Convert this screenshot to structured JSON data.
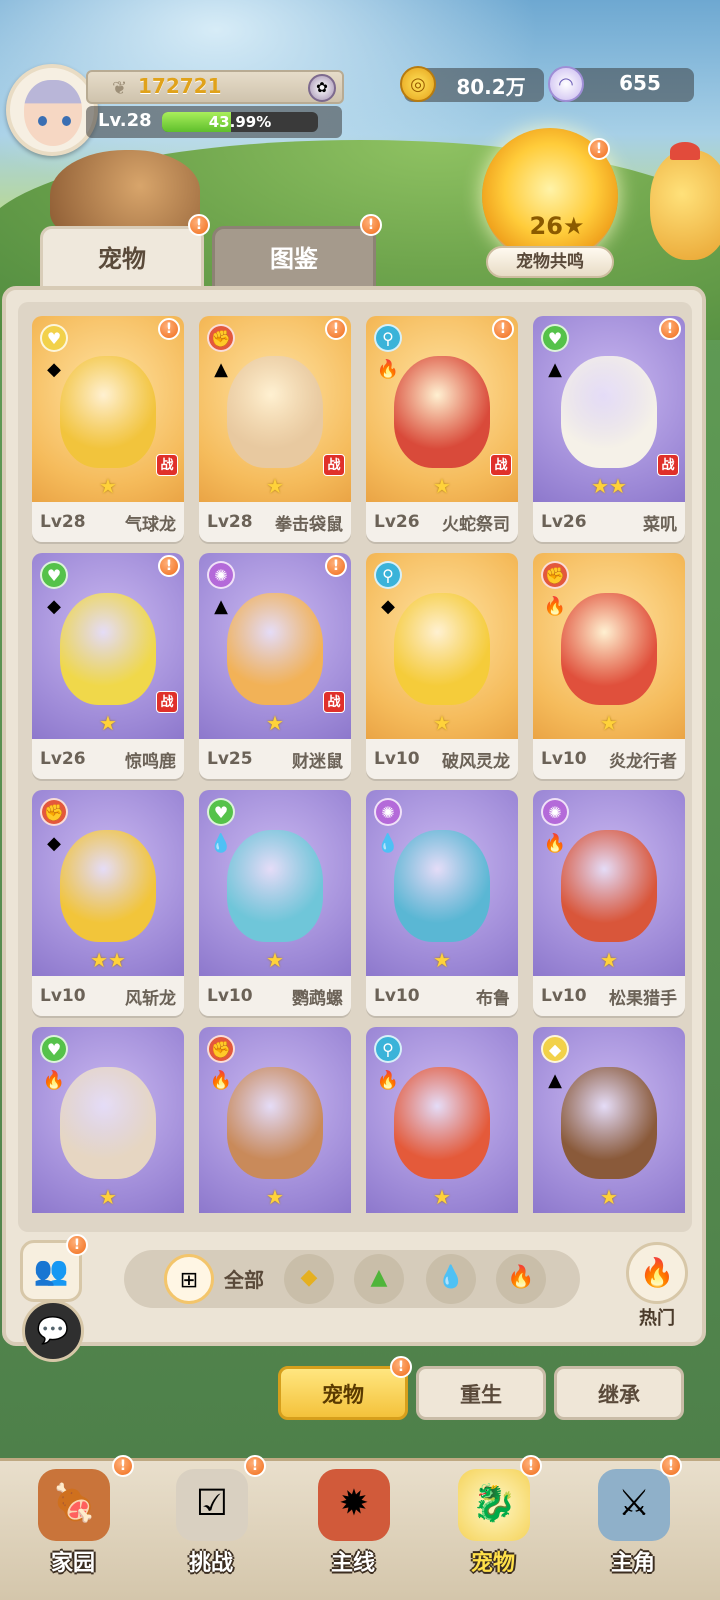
{
  "header": {
    "power": "172721",
    "level": "Lv.28",
    "exp_percent": "43.99%",
    "exp_fraction": 0.4399,
    "coins": "80.2万",
    "shells": "655",
    "resonance_level": "26",
    "resonance_label": "宠物共鸣"
  },
  "tabs": [
    {
      "label": "宠物"
    },
    {
      "label": "图鉴"
    }
  ],
  "pets": [
    {
      "lv": "Lv28",
      "name": "气球龙",
      "stars": "★",
      "card": "gold",
      "battle": "战"
    },
    {
      "lv": "Lv28",
      "name": "拳击袋鼠",
      "stars": "★",
      "card": "gold",
      "battle": "战"
    },
    {
      "lv": "Lv26",
      "name": "火蛇祭司",
      "stars": "★",
      "card": "gold",
      "battle": "战"
    },
    {
      "lv": "Lv26",
      "name": "菜叽",
      "stars": "★★",
      "card": "purple",
      "battle": "战"
    },
    {
      "lv": "Lv26",
      "name": "惊鸣鹿",
      "stars": "★",
      "card": "purple",
      "battle": "战"
    },
    {
      "lv": "Lv25",
      "name": "财迷鼠",
      "stars": "★",
      "card": "purple",
      "battle": "战"
    },
    {
      "lv": "Lv10",
      "name": "破风灵龙",
      "stars": "★",
      "card": "gold",
      "battle": ""
    },
    {
      "lv": "Lv10",
      "name": "炎龙行者",
      "stars": "★",
      "card": "gold",
      "battle": ""
    },
    {
      "lv": "Lv10",
      "name": "风斩龙",
      "stars": "★★",
      "card": "purple",
      "battle": ""
    },
    {
      "lv": "Lv10",
      "name": "鹦鹉螺",
      "stars": "★",
      "card": "purple",
      "battle": ""
    },
    {
      "lv": "Lv10",
      "name": "布鲁",
      "stars": "★",
      "card": "purple",
      "battle": ""
    },
    {
      "lv": "Lv10",
      "name": "松果猎手",
      "stars": "★",
      "card": "purple",
      "battle": ""
    },
    {
      "lv": "",
      "name": "",
      "stars": "★",
      "card": "purple",
      "battle": ""
    },
    {
      "lv": "",
      "name": "",
      "stars": "★",
      "card": "purple",
      "battle": ""
    },
    {
      "lv": "",
      "name": "",
      "stars": "★",
      "card": "purple",
      "battle": ""
    },
    {
      "lv": "",
      "name": "",
      "stars": "★",
      "card": "purple",
      "battle": ""
    }
  ],
  "filter": {
    "all_label": "全部",
    "hot_label": "热门"
  },
  "actions": {
    "pets": "宠物",
    "reborn": "重生",
    "inherit": "继承"
  },
  "nav": [
    {
      "label": "家园",
      "icon": "meat-icon"
    },
    {
      "label": "挑战",
      "icon": "challenge-icon"
    },
    {
      "label": "主线",
      "icon": "mainline-icon"
    },
    {
      "label": "宠物",
      "icon": "pet-icon"
    },
    {
      "label": "主角",
      "icon": "hero-icon"
    }
  ],
  "colors": {
    "gold_card": "#f5bb5b",
    "purple_card": "#9f8bd8",
    "accent": "#f4c23b",
    "notify": "#f06d1a"
  }
}
